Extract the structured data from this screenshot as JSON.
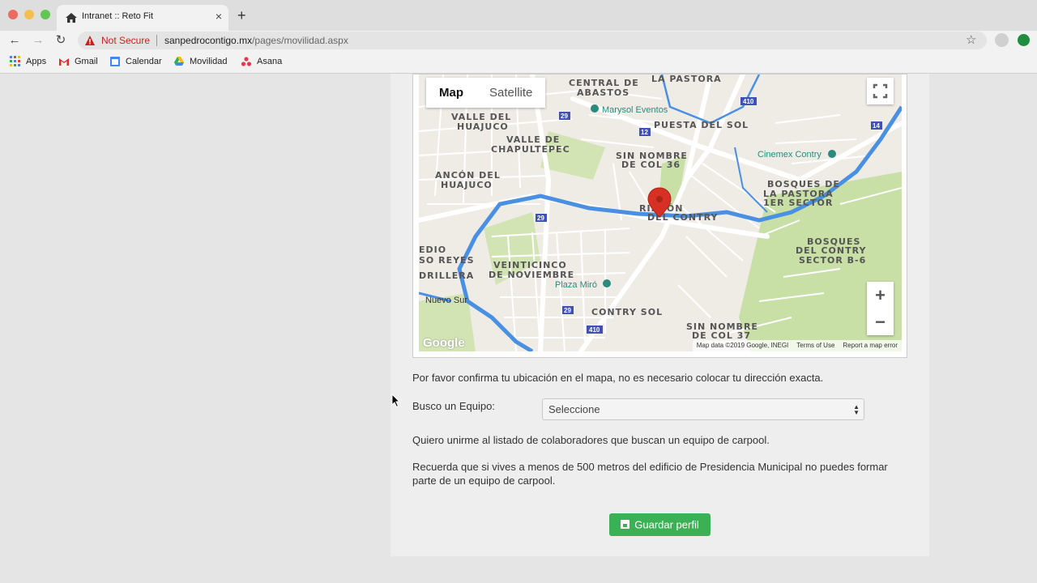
{
  "browser": {
    "tab_title": "Intranet :: Reto Fit",
    "tab_close": "×",
    "new_tab": "+",
    "security_label": "Not Secure",
    "url_host": "sanpedrocontigo.mx",
    "url_path": "/pages/movilidad.aspx",
    "nav_back": "←",
    "nav_forward": "→",
    "nav_reload": "↻",
    "star": "☆"
  },
  "bookmarks": [
    {
      "label": "Apps",
      "icon": "apps-grid-icon"
    },
    {
      "label": "Gmail",
      "icon": "gmail-icon"
    },
    {
      "label": "Calendar",
      "icon": "calendar-icon"
    },
    {
      "label": "Movilidad",
      "icon": "drive-icon"
    },
    {
      "label": "Asana",
      "icon": "asana-icon"
    }
  ],
  "map": {
    "type_map": "Map",
    "type_satellite": "Satellite",
    "zoom_in": "+",
    "zoom_out": "−",
    "google": "Google",
    "attribution_data": "Map data ©2019 Google, INEGI",
    "attribution_terms": "Terms of Use",
    "attribution_report": "Report a map error",
    "places": [
      {
        "label": "LA PASTORA"
      },
      {
        "label": "CENTRAL DE"
      },
      {
        "label": "ABASTOS"
      },
      {
        "label": "Marysol Eventos"
      },
      {
        "label": "VALLE DEL"
      },
      {
        "label": "HUAJUCO"
      },
      {
        "label": "PUESTA DEL SOL"
      },
      {
        "label": "VALLE DE"
      },
      {
        "label": "CHAPULTEPEC"
      },
      {
        "label": "SIN NOMBRE"
      },
      {
        "label": "DE COL 36"
      },
      {
        "label": "Cinemex Contry"
      },
      {
        "label": "ANCÓN DEL"
      },
      {
        "label": "HUAJUCO"
      },
      {
        "label": "BOSQUES DE"
      },
      {
        "label": "LA PASTORA"
      },
      {
        "label": "1ER SECTOR"
      },
      {
        "label": "RINCÓN"
      },
      {
        "label": "DEL CONTRY"
      },
      {
        "label": "BOSQUES"
      },
      {
        "label": "DEL CONTRY"
      },
      {
        "label": "SECTOR B-6"
      },
      {
        "label": "VEINTICINCO"
      },
      {
        "label": "DE NOVIEMBRE"
      },
      {
        "label": "Plaza Miró"
      },
      {
        "label": "Nuevo Sur"
      },
      {
        "label": "CONTRY SOL"
      },
      {
        "label": "SIN NOMBRE"
      },
      {
        "label": "DE COL 37"
      },
      {
        "label": "EDIO"
      },
      {
        "label": "SO REYES"
      },
      {
        "label": "DRILLERA"
      }
    ],
    "route_labels": [
      "410",
      "29",
      "12",
      "14",
      "29",
      "29",
      "410"
    ]
  },
  "form": {
    "confirm_text": "Por favor confirma tu ubicación en el mapa, no es necesario colocar tu dirección exacta.",
    "team_label": "Busco un Equipo:",
    "team_select_value": "Seleccione",
    "join_text": "Quiero unirme al listado de colaboradores que buscan un equipo de carpool.",
    "distance_text": "Recuerda que si vives a menos de 500 metros del edificio de Presidencia Municipal no puedes formar parte de un equipo de carpool.",
    "save_label": "Guardar perfil"
  },
  "colors": {
    "save_button": "#3cb054",
    "map_road_major": "#ffffff",
    "map_river": "#4a90e2",
    "map_park": "#c8dfa6",
    "pin": "#d93025",
    "not_secure": "#c5221f"
  }
}
